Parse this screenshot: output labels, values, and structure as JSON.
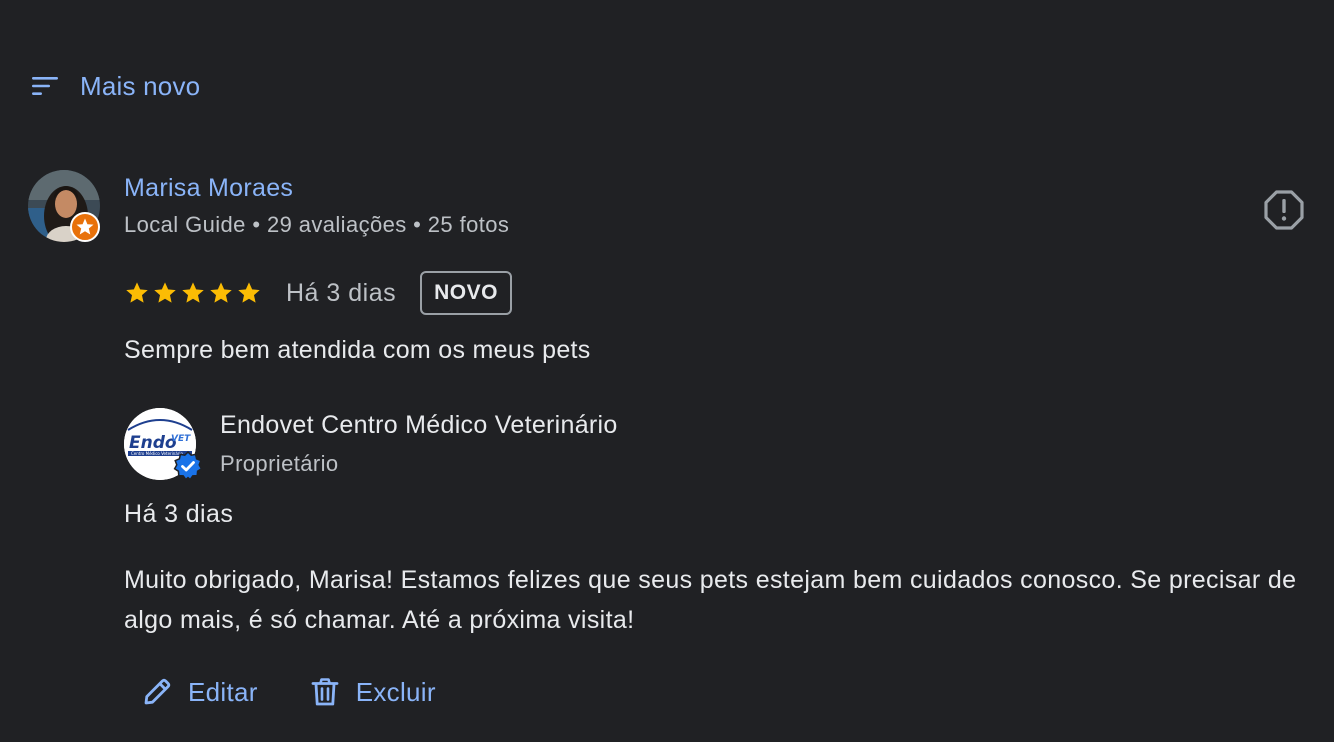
{
  "sort": {
    "icon": "sort-icon",
    "label": "Mais novo"
  },
  "review": {
    "reviewer_name": "Marisa Moraes",
    "reviewer_meta": "Local Guide • 29 avaliações • 25 fotos",
    "rating": 5,
    "rating_max": 5,
    "date": "Há 3 dias",
    "badge": "NOVO",
    "text": "Sempre bem atendida com os meus pets",
    "report_icon": "report-icon"
  },
  "response": {
    "owner_name": "Endovet Centro Médico Veterinário",
    "owner_role": "Proprietário",
    "logo_text": "Endo",
    "logo_text_2": "VET",
    "logo_subtext": "Centro Médico Veterinário",
    "date": "Há 3 dias",
    "text": "Muito obrigado, Marisa! Estamos felizes que seus pets estejam bem cuidados conosco. Se precisar de algo mais, é só chamar. Até a próxima visita!"
  },
  "actions": {
    "edit_label": "Editar",
    "delete_label": "Excluir"
  },
  "colors": {
    "background": "#202124",
    "link": "#8ab4f8",
    "star": "#fbbc04",
    "guide_badge": "#e8710a",
    "verified": "#1a73e8"
  }
}
